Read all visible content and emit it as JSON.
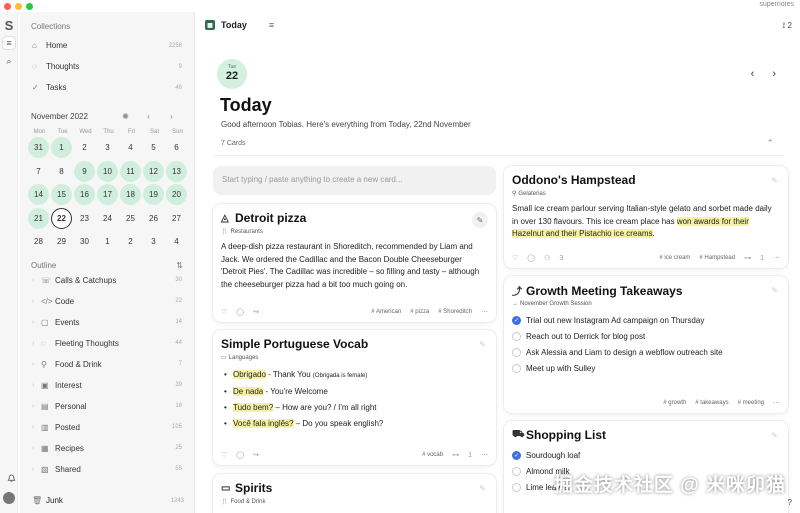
{
  "window": {
    "app_name": "supernotes",
    "traffic": [
      "#ff5f57",
      "#febc2e",
      "#28c840"
    ]
  },
  "rail": {
    "logo": "S",
    "items": [
      {
        "icon": "sliders-icon",
        "glyph": "≡"
      },
      {
        "icon": "search-icon",
        "glyph": "⌕"
      }
    ],
    "bell_glyph": "🔔"
  },
  "sidebar": {
    "collections_title": "Collections",
    "collections": [
      {
        "icon": "home-icon",
        "glyph": "⌂",
        "label": "Home",
        "count": "2258"
      },
      {
        "icon": "thoughts-icon",
        "glyph": "◌",
        "label": "Thoughts",
        "count": "9"
      },
      {
        "icon": "tasks-icon",
        "glyph": "✓",
        "label": "Tasks",
        "count": "46"
      }
    ],
    "calendar": {
      "month": "November 2022",
      "weekdays": [
        "Mon",
        "Tue",
        "Wed",
        "Thu",
        "Fri",
        "Sat",
        "Sun"
      ],
      "days": [
        {
          "n": "31",
          "hi": true
        },
        {
          "n": "1",
          "hi": true
        },
        {
          "n": "2",
          "hi": false
        },
        {
          "n": "3",
          "hi": false
        },
        {
          "n": "4",
          "hi": false
        },
        {
          "n": "5",
          "hi": false
        },
        {
          "n": "6",
          "hi": false
        },
        {
          "n": "7",
          "hi": false
        },
        {
          "n": "8",
          "hi": false
        },
        {
          "n": "9",
          "hi": true
        },
        {
          "n": "10",
          "hi": true
        },
        {
          "n": "11",
          "hi": true
        },
        {
          "n": "12",
          "hi": true
        },
        {
          "n": "13",
          "hi": true
        },
        {
          "n": "14",
          "hi": true
        },
        {
          "n": "15",
          "hi": true
        },
        {
          "n": "16",
          "hi": true
        },
        {
          "n": "17",
          "hi": true
        },
        {
          "n": "18",
          "hi": true
        },
        {
          "n": "19",
          "hi": true
        },
        {
          "n": "20",
          "hi": true
        },
        {
          "n": "21",
          "hi": true
        },
        {
          "n": "22",
          "hi": false,
          "today": true
        },
        {
          "n": "23",
          "hi": false
        },
        {
          "n": "24",
          "hi": false
        },
        {
          "n": "25",
          "hi": false
        },
        {
          "n": "26",
          "hi": false
        },
        {
          "n": "27",
          "hi": false
        },
        {
          "n": "28",
          "hi": false
        },
        {
          "n": "29",
          "hi": false
        },
        {
          "n": "30",
          "hi": false
        },
        {
          "n": "1",
          "hi": false
        },
        {
          "n": "2",
          "hi": false
        },
        {
          "n": "3",
          "hi": false
        },
        {
          "n": "4",
          "hi": false
        }
      ]
    },
    "outline_title": "Outline",
    "outline": [
      {
        "icon": "phone-icon",
        "glyph": "☏",
        "label": "Calls & Catchups",
        "count": "30"
      },
      {
        "icon": "code-icon",
        "glyph": "</>",
        "label": "Code",
        "count": "22"
      },
      {
        "icon": "events-icon",
        "glyph": "▢",
        "label": "Events",
        "count": "14"
      },
      {
        "icon": "fleeting-icon",
        "glyph": "◌",
        "label": "Fleeting Thoughts",
        "count": "44"
      },
      {
        "icon": "food-icon",
        "glyph": "⚲",
        "label": "Food & Drink",
        "count": "7"
      },
      {
        "icon": "interest-icon",
        "glyph": "▣",
        "label": "Interest",
        "count": "39"
      },
      {
        "icon": "personal-icon",
        "glyph": "▤",
        "label": "Personal",
        "count": "18"
      },
      {
        "icon": "posted-icon",
        "glyph": "▥",
        "label": "Posted",
        "count": "105"
      },
      {
        "icon": "recipes-icon",
        "glyph": "▦",
        "label": "Recipes",
        "count": "25"
      },
      {
        "icon": "shared-icon",
        "glyph": "▧",
        "label": "Shared",
        "count": "55"
      }
    ],
    "junk": {
      "label": "Junk",
      "count": "1243"
    }
  },
  "topbar": {
    "title": "Today",
    "cal_glyph": "▦",
    "filter_glyph": "≡",
    "notif": "2"
  },
  "hero": {
    "weekday": "Tue",
    "day": "22",
    "title": "Today",
    "subtitle": "Good afternoon Tobias. Here's everything from Today, 22nd November",
    "count": "7 Cards"
  },
  "compose_placeholder": "Start typing / paste anything to create a new card...",
  "cards": {
    "pizza": {
      "title": "Detroit pizza",
      "tag_label": "Restaurants",
      "body": "A deep-dish pizza restaurant in Shoreditch, recommended by Liam and Jack. We ordered the Cadillac and the Bacon Double Cheeseburger 'Detroit Pies'. The Cadillac was incredible – so filling and tasty – although the cheeseburger pizza had a bit too much going on.",
      "tags": [
        "# American",
        "# pizza",
        "# Shoreditch"
      ]
    },
    "vocab": {
      "title": "Simple Portuguese Vocab",
      "tag_label": "Languages",
      "items": [
        {
          "hl": "Obrigado",
          "rest": " - Thank You ",
          "small": "(Obrigada is female)"
        },
        {
          "hl": "De nada",
          "rest": " - You're Welcome",
          "small": ""
        },
        {
          "hl": "Tudo bem?",
          "rest": " – How are you? / I'm all right",
          "small": ""
        },
        {
          "hl": "Você fala inglês?",
          "rest": " – Do you speak english?",
          "small": ""
        }
      ],
      "tags": [
        "# vocab"
      ],
      "count": "1"
    },
    "spirits": {
      "title": "Spirits",
      "tag_label": "Food & Drink"
    },
    "oddono": {
      "title": "Oddono's Hampstead",
      "tag_label": "Gelaterias",
      "body_plain": "Small ice cream parlour serving Italian-style gelato and sorbet made daily in over 130 flavours. This ice cream place has ",
      "body_hl": "won awards for their Hazelnut and their Pistachio ice creams",
      "body_end": ".",
      "tags": [
        "# ice cream",
        "# Hampstead"
      ],
      "count": "1",
      "reply_count": "3"
    },
    "growth": {
      "title": "Growth Meeting Takeaways",
      "tag_label": "November Growth Session",
      "todos": [
        {
          "label": "Trial out new Instagram Ad campaign on Thursday",
          "done": true
        },
        {
          "label": "Reach out to Derrick for blog post",
          "done": false
        },
        {
          "label": "Ask Alessia and Liam to design a webflow outreach site",
          "done": false
        },
        {
          "label": "Meet up with Sulley",
          "done": false
        }
      ],
      "tags": [
        "# growth",
        "# takeaways",
        "# meeting"
      ]
    },
    "shopping": {
      "title": "Shopping List",
      "todos": [
        {
          "label": "Sourdough loaf",
          "done": true
        },
        {
          "label": "Almond milk",
          "done": false
        },
        {
          "label": "Lime leaves",
          "done": false
        }
      ]
    }
  },
  "watermark": "掘金技术社区 @ 米咪卯猫"
}
